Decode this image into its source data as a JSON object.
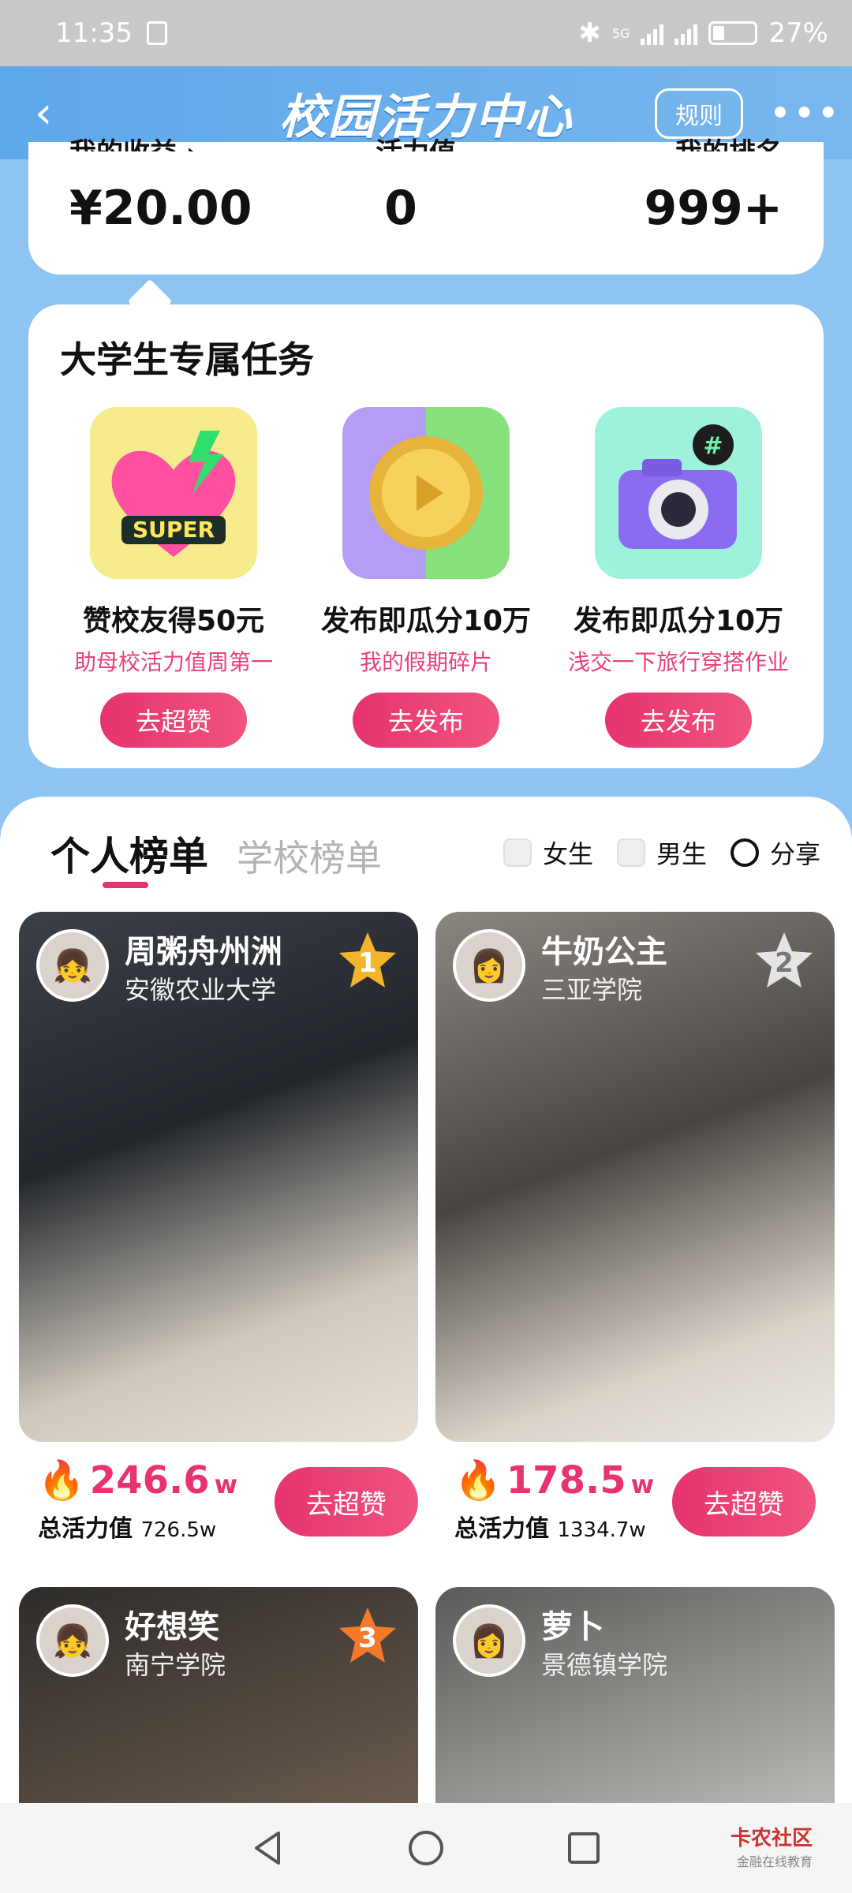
{
  "status_bar": {
    "time": "11:35",
    "network": "5G",
    "battery": "27%"
  },
  "header": {
    "title": "校园活力中心",
    "rules_label": "规则",
    "more_label": "•••",
    "back_label": "‹"
  },
  "stats": {
    "labels": [
      "我的收益 ›",
      "活力值",
      "我的排名"
    ],
    "values": [
      "¥20.00",
      "0",
      "999+"
    ]
  },
  "tasks": {
    "title": "大学生专属任务",
    "items": [
      {
        "name": "赞校友得50元",
        "sub": "助母校活力值周第一",
        "button": "去超赞",
        "tile_text": "SUPER"
      },
      {
        "name": "发布即瓜分10万",
        "sub": "我的假期碎片",
        "button": "去发布"
      },
      {
        "name": "发布即瓜分10万",
        "sub": "浅交一下旅行穿搭作业",
        "button": "去发布",
        "tile_text": "#"
      }
    ]
  },
  "board": {
    "tab_personal": "个人榜单",
    "tab_school": "学校榜单",
    "filter_female": "女生",
    "filter_male": "男生",
    "share": "分享"
  },
  "entries": [
    {
      "name": "周粥舟州洲",
      "school": "安徽农业大学",
      "rank": "1",
      "hot": "246.6",
      "hot_unit": "w",
      "total_label": "总活力值",
      "total": "726.5w",
      "button": "去超赞"
    },
    {
      "name": "牛奶公主",
      "school": "三亚学院",
      "rank": "2",
      "hot": "178.5",
      "hot_unit": "w",
      "total_label": "总活力值",
      "total": "1334.7w",
      "button": "去超赞"
    },
    {
      "name": "好想笑",
      "school": "南宁学院",
      "rank": "3"
    },
    {
      "name": "萝卜",
      "school": "景德镇学院"
    }
  ],
  "watermark": {
    "line1": "卡农社区",
    "line2": "金融在线教育"
  },
  "colors": {
    "accent": "#e8336e",
    "header_blue": "#5ea7ea",
    "page_bg": "#8ec4f2"
  }
}
